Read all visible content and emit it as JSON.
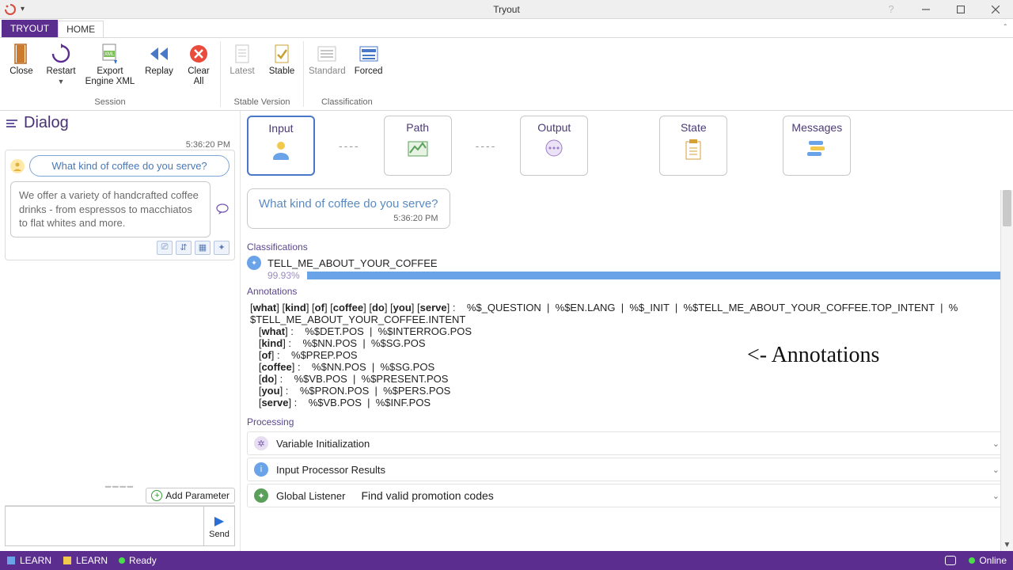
{
  "window": {
    "title": "Tryout"
  },
  "tabs": {
    "tryout": "TRYOUT",
    "home": "HOME"
  },
  "ribbon": {
    "session": {
      "label": "Session",
      "close": "Close",
      "restart": "Restart",
      "export": "Export\nEngine XML",
      "replay": "Replay",
      "clearall": "Clear\nAll"
    },
    "stable": {
      "label": "Stable Version",
      "latest": "Latest",
      "stable": "Stable"
    },
    "classification": {
      "label": "Classification",
      "standard": "Standard",
      "forced": "Forced"
    }
  },
  "dialog": {
    "header": "Dialog",
    "timestamp": "5:36:20 PM",
    "user_msg": "What kind of coffee do you serve?",
    "bot_msg": "We offer a variety of handcrafted coffee drinks - from espressos to macchiatos to flat whites and more.",
    "add_param": "Add Parameter",
    "send": "Send"
  },
  "pipeline": {
    "input": "Input",
    "path": "Path",
    "output": "Output",
    "state": "State",
    "messages": "Messages",
    "card_text": "What kind of coffee do you serve?",
    "card_ts": "5:36:20 PM"
  },
  "sections": {
    "classifications": "Classifications",
    "class_name": "TELL_ME_ABOUT_YOUR_COFFEE",
    "class_pct": "99.93%",
    "annotations": "Annotations",
    "processing": "Processing"
  },
  "annotations": {
    "line1_a": "[",
    "w_what": "what",
    "line1_b": "] [",
    "w_kind": "kind",
    "line1_c": "] [",
    "w_of": "of",
    "line1_d": "] [",
    "w_coffee": "coffee",
    "line1_e": "] [",
    "w_do": "do",
    "line1_f": "] [",
    "w_you": "you",
    "line1_g": "] [",
    "w_serve": "serve",
    "line1_h": "] :    %$_QUESTION  |  %$EN.LANG  |  %$_INIT  |  %$TELL_ME_ABOUT_YOUR_COFFEE.TOP_INTENT  |  %",
    "line2": "$TELL_ME_ABOUT_YOUR_COFFEE.INTENT",
    "l_what": "   [what] :    %$DET.POS  |  %$INTERROG.POS",
    "l_kind": "   [kind] :    %$NN.POS  |  %$SG.POS",
    "l_of": "   [of] :    %$PREP.POS",
    "l_coffee": "   [coffee] :    %$NN.POS  |  %$SG.POS",
    "l_do": "   [do] :    %$VB.POS  |  %$PRESENT.POS",
    "l_you": "   [you] :    %$PRON.POS  |  %$PERS.POS",
    "l_serve": "   [serve] :    %$VB.POS  |  %$INF.POS",
    "handnote": "<- Annotations"
  },
  "processing": {
    "var_init": "Variable Initialization",
    "ipr": "Input Processor Results",
    "gl": "Global Listener",
    "gl_val": "Find valid promotion codes"
  },
  "status": {
    "learn1": "LEARN",
    "learn2": "LEARN",
    "ready": "Ready",
    "online": "Online"
  }
}
